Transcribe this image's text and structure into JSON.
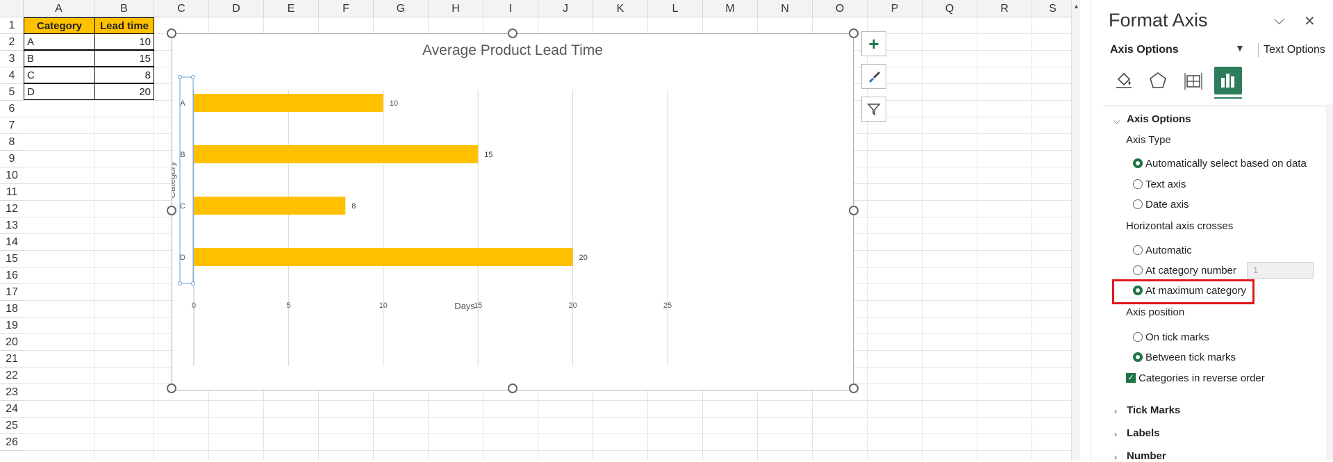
{
  "spreadsheet": {
    "columns": [
      "A",
      "B",
      "C",
      "D",
      "E",
      "F",
      "G",
      "H",
      "I",
      "J",
      "K",
      "L",
      "M",
      "N",
      "O",
      "P",
      "Q",
      "R",
      "S"
    ],
    "rows": [
      "1",
      "2",
      "3",
      "4",
      "5",
      "6",
      "7",
      "8",
      "9",
      "10",
      "11",
      "12",
      "13",
      "14",
      "15",
      "16",
      "17",
      "18",
      "19",
      "20",
      "21",
      "22",
      "23",
      "24",
      "25",
      "26"
    ],
    "table": {
      "header": [
        "Category",
        "Lead time"
      ],
      "rows": [
        [
          "A",
          "10"
        ],
        [
          "B",
          "15"
        ],
        [
          "C",
          "8"
        ],
        [
          "D",
          "20"
        ]
      ]
    }
  },
  "chart": {
    "title": "Average Product Lead Time",
    "side_buttons": [
      "chart-elements-plus-icon",
      "chart-styles-brush-icon",
      "chart-filter-funnel-icon"
    ]
  },
  "chart_data": {
    "type": "bar",
    "orientation": "horizontal",
    "title": "Average Product Lead Time",
    "xlabel": "Days",
    "ylabel": "Category",
    "categories": [
      "A",
      "B",
      "C",
      "D"
    ],
    "values": [
      10,
      15,
      8,
      20
    ],
    "data_labels": [
      "10",
      "15",
      "8",
      "20"
    ],
    "xlim": [
      0,
      25
    ],
    "x_ticks": [
      "0",
      "5",
      "10",
      "15",
      "20",
      "25"
    ],
    "bar_color": "#FFC000",
    "grid": true,
    "categories_reversed": true
  },
  "pane": {
    "title": "Format Axis",
    "tab_axis_options": "Axis Options",
    "tab_text_options": "Text Options",
    "icons": [
      "fill-line-icon",
      "effects-pentagon-icon",
      "size-properties-icon",
      "axis-options-chart-icon"
    ],
    "section_axis_options": "Axis Options",
    "axis_type_label": "Axis Type",
    "axis_type_auto": "Automatically select based on data",
    "axis_type_text": "Text axis",
    "axis_type_date": "Date axis",
    "h_axis_crosses_label": "Horizontal axis crosses",
    "crosses_automatic": "Automatic",
    "crosses_at_category": "At category number",
    "crosses_at_category_value": "1",
    "crosses_at_max": "At maximum category",
    "axis_position_label": "Axis position",
    "pos_on_tick": "On tick marks",
    "pos_between": "Between tick marks",
    "reverse_order": "Categories in reverse order",
    "section_tick_marks": "Tick Marks",
    "section_labels": "Labels",
    "section_number": "Number",
    "accent": "#217346",
    "highlight_color": "#E0151C"
  }
}
